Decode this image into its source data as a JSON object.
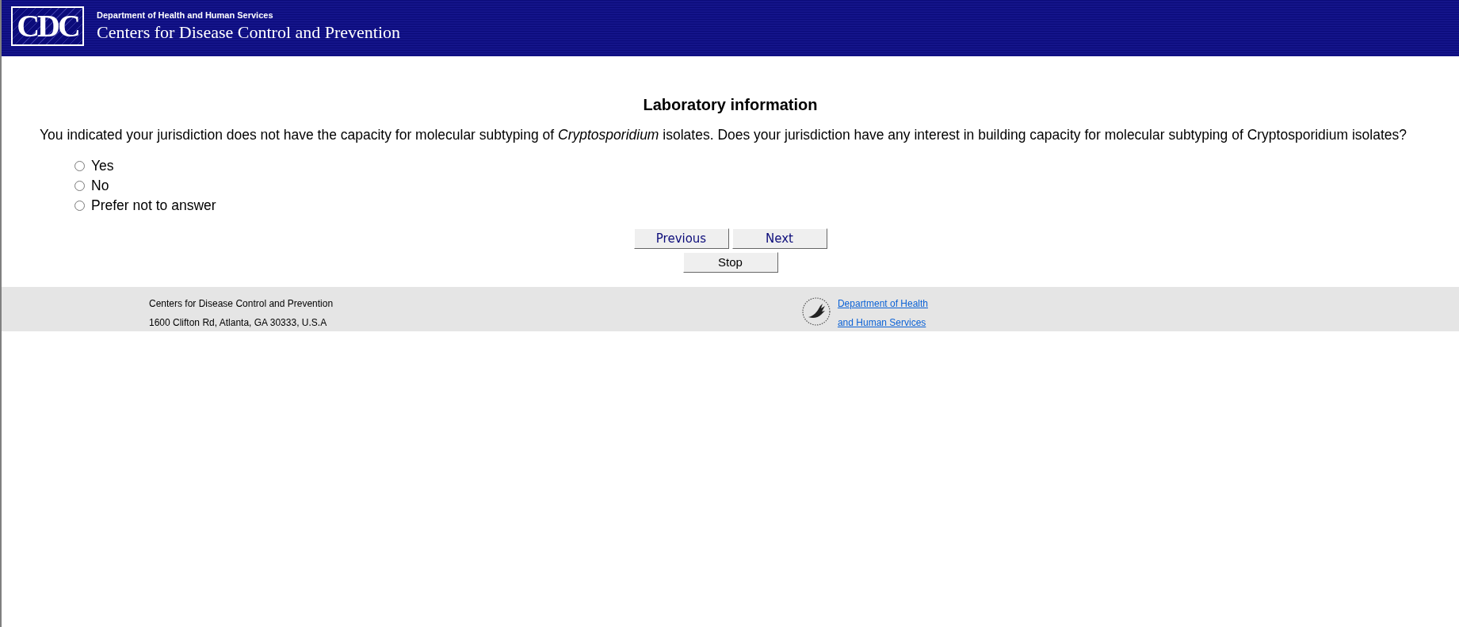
{
  "header": {
    "logo": "CDC",
    "department": "Department of Health and Human Services",
    "agency": "Centers for Disease Control and Prevention"
  },
  "page_title": "Laboratory information",
  "question": "You indicated your jurisdiction does not have the capacity for molecular subtyping of *Cryptosporidium* isolates. Does your jurisdiction have any interest in building capacity for molecular subtyping of Cryptosporidium isolates?",
  "options": [
    {
      "label": "Yes",
      "selected": false
    },
    {
      "label": "No",
      "selected": false
    },
    {
      "label": "Prefer not to answer",
      "selected": false
    }
  ],
  "buttons": [
    {
      "label": "Previous",
      "kind": "navigation"
    },
    {
      "label": "Next",
      "kind": "navigation"
    },
    {
      "label": "Stop",
      "kind": "action"
    }
  ],
  "footer": {
    "address_lines": [
      "Centers for Disease Control and Prevention",
      "1600 Clifton Rd, Atlanta, GA 30333, U.S.A"
    ],
    "links": [
      "Department of Health",
      "and Human Services"
    ]
  }
}
